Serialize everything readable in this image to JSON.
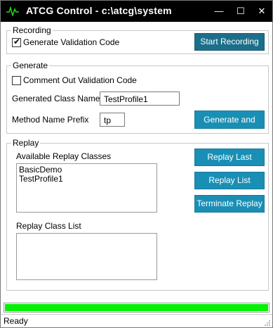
{
  "window": {
    "title": "ATCG Control - c:\\atcg\\system",
    "controls": {
      "minimize": "—",
      "maximize": "☐",
      "close": "✕"
    },
    "icon": "waveform-icon"
  },
  "recording": {
    "legend": "Recording",
    "generate_validation_code_label": "Generate Validation Code",
    "generate_validation_code_checked": true,
    "start_recording_button": "Start Recording"
  },
  "generate": {
    "legend": "Generate",
    "comment_out_label": "Comment Out Validation Code",
    "comment_out_checked": false,
    "class_name_label": "Generated Class Name",
    "class_name_value": "TestProfile1",
    "prefix_label": "Method Name Prefix",
    "prefix_value": "tp",
    "generate_and_load_button": "Generate and Load"
  },
  "replay": {
    "legend": "Replay",
    "available_label": "Available Replay Classes",
    "available_items": [
      "BasicDemo",
      "TestProfile1"
    ],
    "class_list_label": "Replay Class List",
    "replay_last_button": "Replay Last",
    "replay_list_button": "Replay List",
    "terminate_button": "Terminate Replay"
  },
  "progress": {
    "fraction": 1.0,
    "color": "#06f006"
  },
  "status": {
    "text": "Ready"
  },
  "colors": {
    "accent": "#1a8fb5",
    "accent_dark": "#1c6f8a",
    "titlebar": "#000000"
  }
}
